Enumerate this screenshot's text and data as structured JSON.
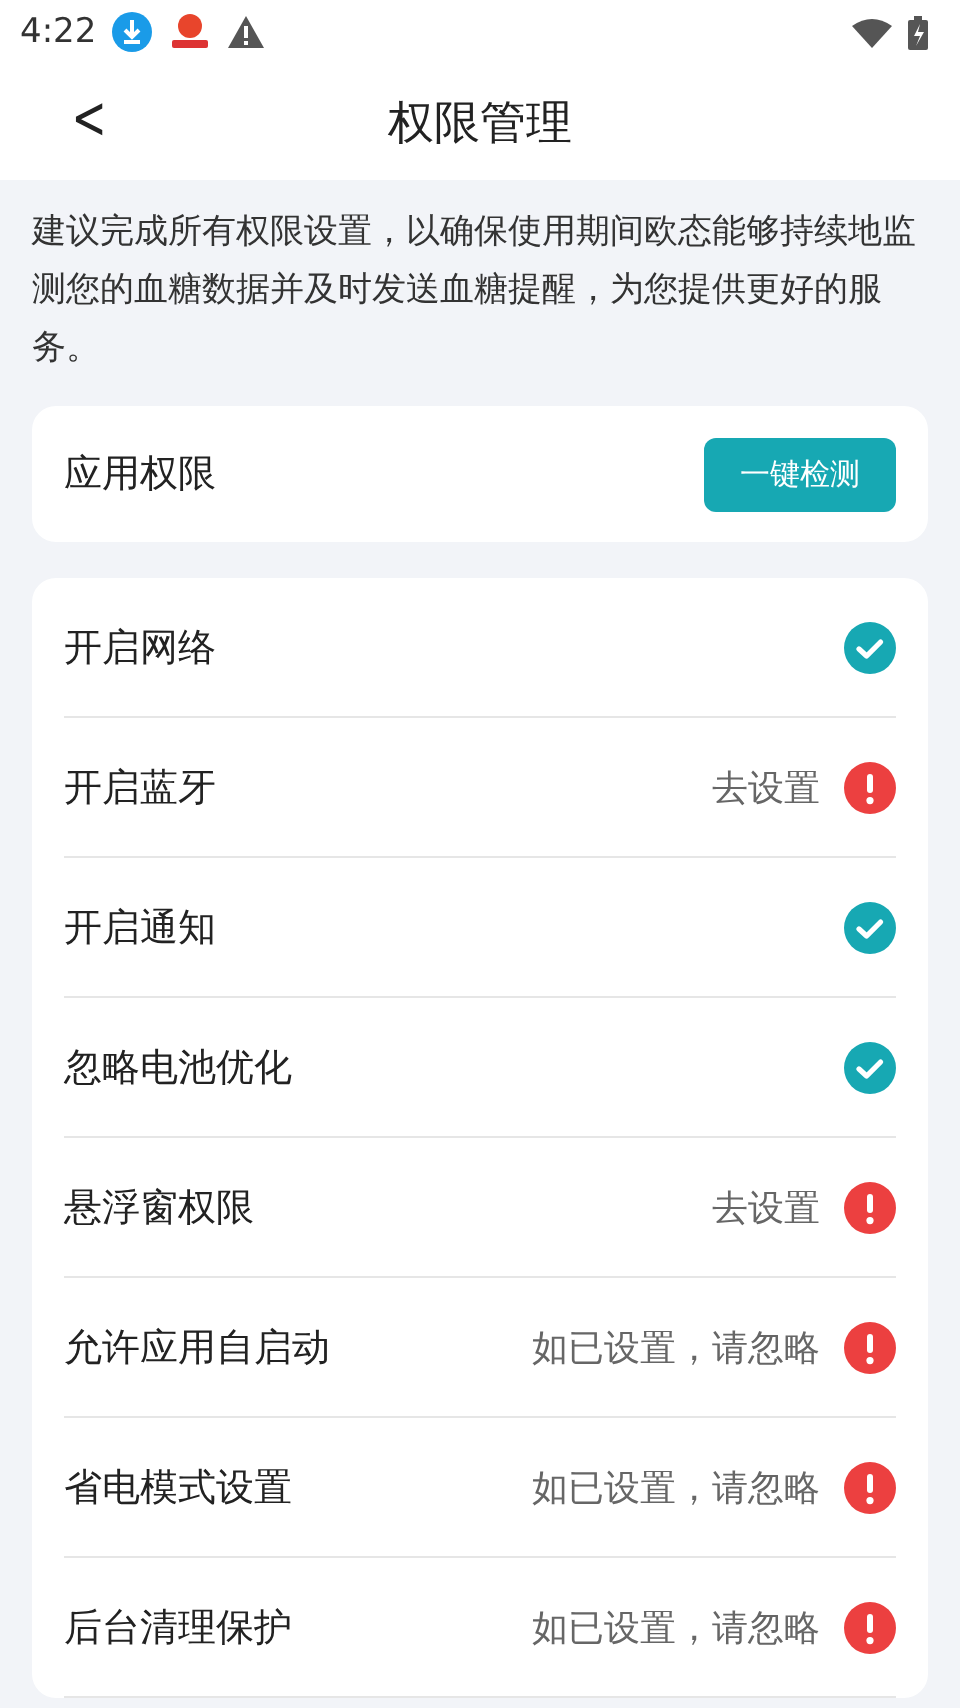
{
  "status_bar": {
    "time": "4:22"
  },
  "nav": {
    "back": "<",
    "title": "权限管理"
  },
  "intro": "建议完成所有权限设置，以确保使用期间欧态能够持续地监测您的血糖数据并及时发送血糖提醒，为您提供更好的服务。",
  "app_permissions": {
    "label": "应用权限",
    "button": "一键检测"
  },
  "permissions": [
    {
      "name": "开启网络",
      "granted": true
    },
    {
      "name": "开启蓝牙",
      "granted": false,
      "action": "去设置"
    },
    {
      "name": "开启通知",
      "granted": true
    },
    {
      "name": "忽略电池优化",
      "granted": true
    },
    {
      "name": "悬浮窗权限",
      "granted": false,
      "action": "去设置"
    },
    {
      "name": "允许应用自启动",
      "granted": false,
      "action": "如已设置，请忽略"
    },
    {
      "name": "省电模式设置",
      "granted": false,
      "action": "如已设置，请忽略"
    },
    {
      "name": "后台清理保护",
      "granted": false,
      "action": "如已设置，请忽略"
    }
  ]
}
